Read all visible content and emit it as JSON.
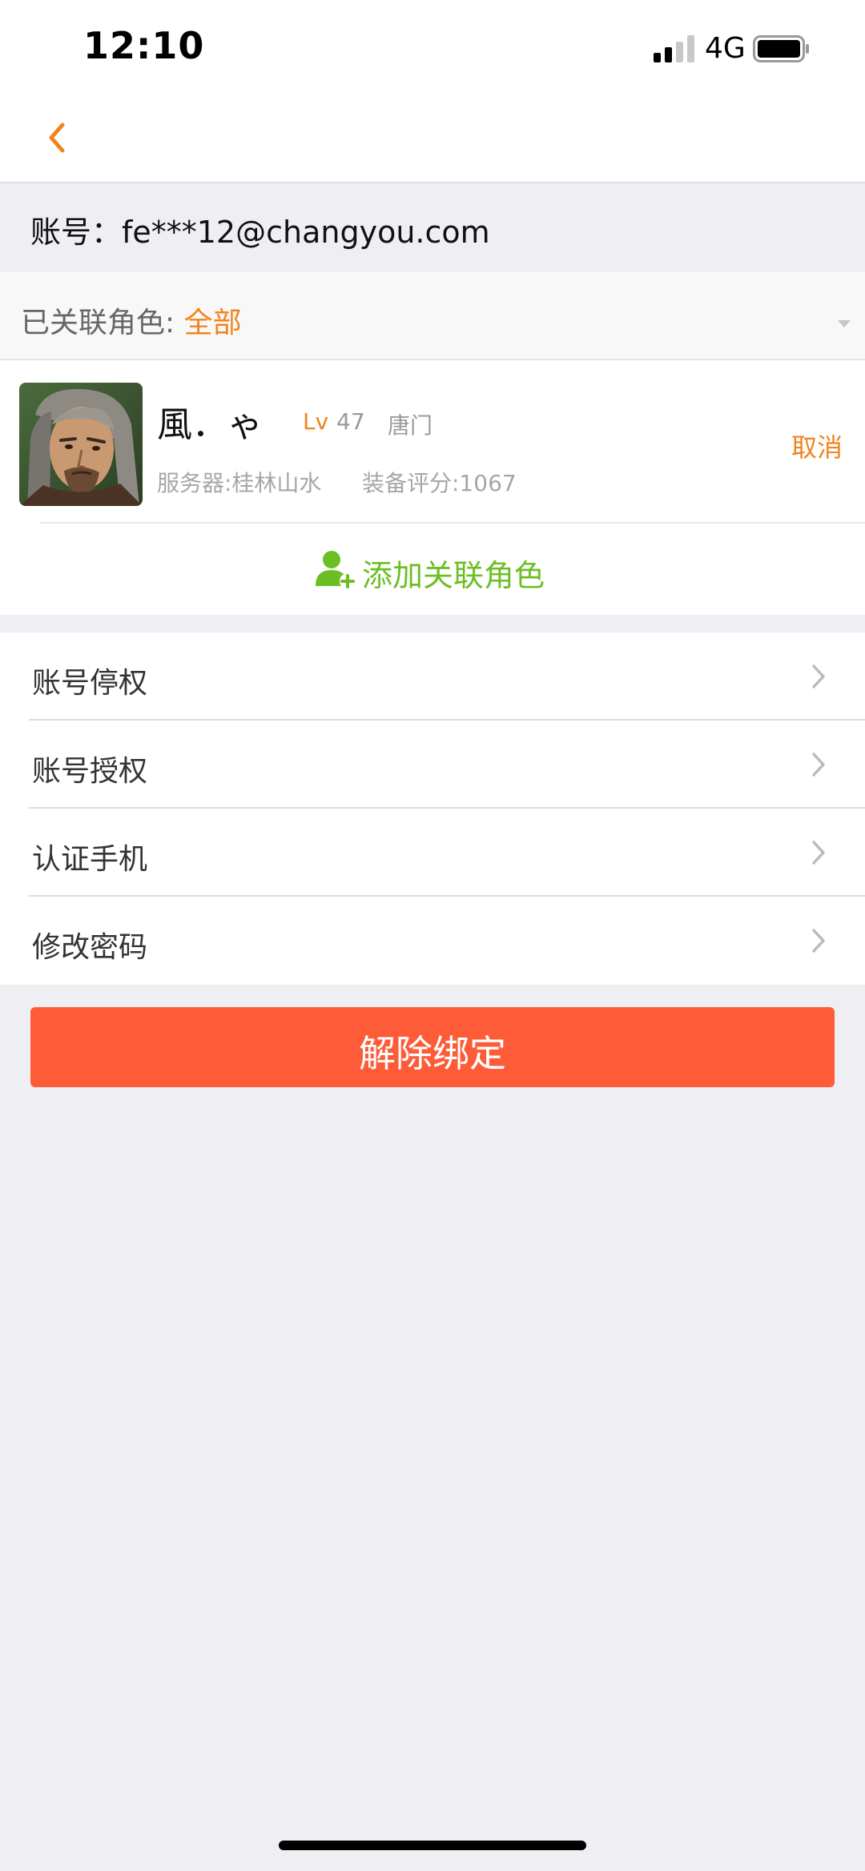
{
  "status_bar": {
    "time": "12:10",
    "network": "4G"
  },
  "account": {
    "label": "账号：fe***12@changyou.com"
  },
  "roles_filter": {
    "label": "已关联角色: ",
    "value": "全部"
  },
  "role": {
    "name": "風．ゃ",
    "level_label": "Lv",
    "level": "47",
    "school": "唐门",
    "server": "服务器:桂林山水",
    "score": "装备评分:1067",
    "cancel_label": "取消"
  },
  "add_role_label": "添加关联角色",
  "menu": {
    "items": [
      {
        "label": "账号停权"
      },
      {
        "label": "账号授权"
      },
      {
        "label": "认证手机"
      },
      {
        "label": "修改密码"
      }
    ]
  },
  "unbind_label": "解除绑定",
  "colors": {
    "accent_orange": "#f0841e",
    "add_green": "#6cbf23",
    "unbind_red": "#fe5c38",
    "background": "#efeef3"
  },
  "icons": {
    "back": "chevron-left-icon",
    "add_role": "add-user-icon",
    "menu_arrow": "chevron-right-icon"
  }
}
